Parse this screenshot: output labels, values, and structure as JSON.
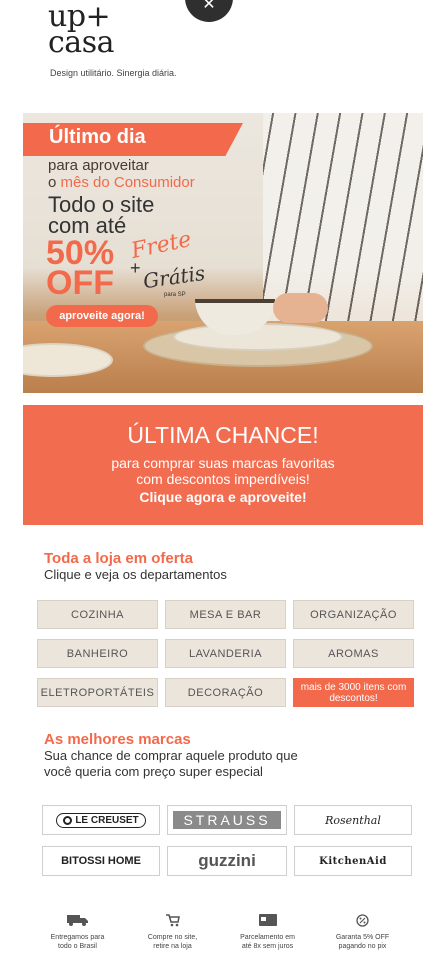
{
  "popup": {
    "close_label": "✕"
  },
  "logo": {
    "line1": "up+",
    "line2": "casa",
    "tagline": "Design utilitário. Sinergia diária."
  },
  "hero": {
    "banner": "Último dia",
    "line1": "para aproveitar",
    "line2_prefix": "o ",
    "line2_highlight": "mês do Consumidor",
    "line3": "Todo o site",
    "line4": "com até",
    "discount": "50%",
    "off": "OFF",
    "plus": "+",
    "frete": "Frete",
    "gratis": "Grátis",
    "sp_note": "para SP",
    "cta": "aproveite agora!"
  },
  "chance": {
    "title": "ÚLTIMA CHANCE!",
    "subtitle_line1": "para comprar suas marcas favoritas",
    "subtitle_line2": "com descontos imperdíveis!",
    "cta": "Clique agora e aproveite!"
  },
  "departments_section": {
    "title": "Toda a loja em oferta",
    "subtitle": "Clique e veja os departamentos",
    "items": [
      "COZINHA",
      "MESA E BAR",
      "ORGANIZAÇÃO",
      "BANHEIRO",
      "LAVANDERIA",
      "AROMAS",
      "ELETROPORTÁTEIS",
      "DECORAÇÃO"
    ],
    "highlight": "mais de 3000 itens com descontos!"
  },
  "brands_section": {
    "title": "As melhores marcas",
    "subtitle_line1": "Sua chance de comprar aquele produto que",
    "subtitle_line2": "você queria com preço super especial",
    "brands": [
      "LE CREUSET",
      "STRAUSS",
      "Rosenthal",
      "BITOSSI HOME",
      "guzzini",
      "KitchenAid"
    ]
  },
  "features": [
    {
      "icon": "truck-icon",
      "line1": "Entregamos para",
      "line2": "todo o Brasil"
    },
    {
      "icon": "cart-icon",
      "line1": "Compre no site,",
      "line2": "retire na loja"
    },
    {
      "icon": "credit-card-icon",
      "line1": "Parcelamento em",
      "line2": "até 8x sem juros"
    },
    {
      "icon": "percent-icon",
      "line1": "Garanta 5% OFF",
      "line2": "pagando no pix"
    }
  ],
  "colors": {
    "accent": "#f26a4b",
    "dept_bg": "#ebe5dc"
  }
}
